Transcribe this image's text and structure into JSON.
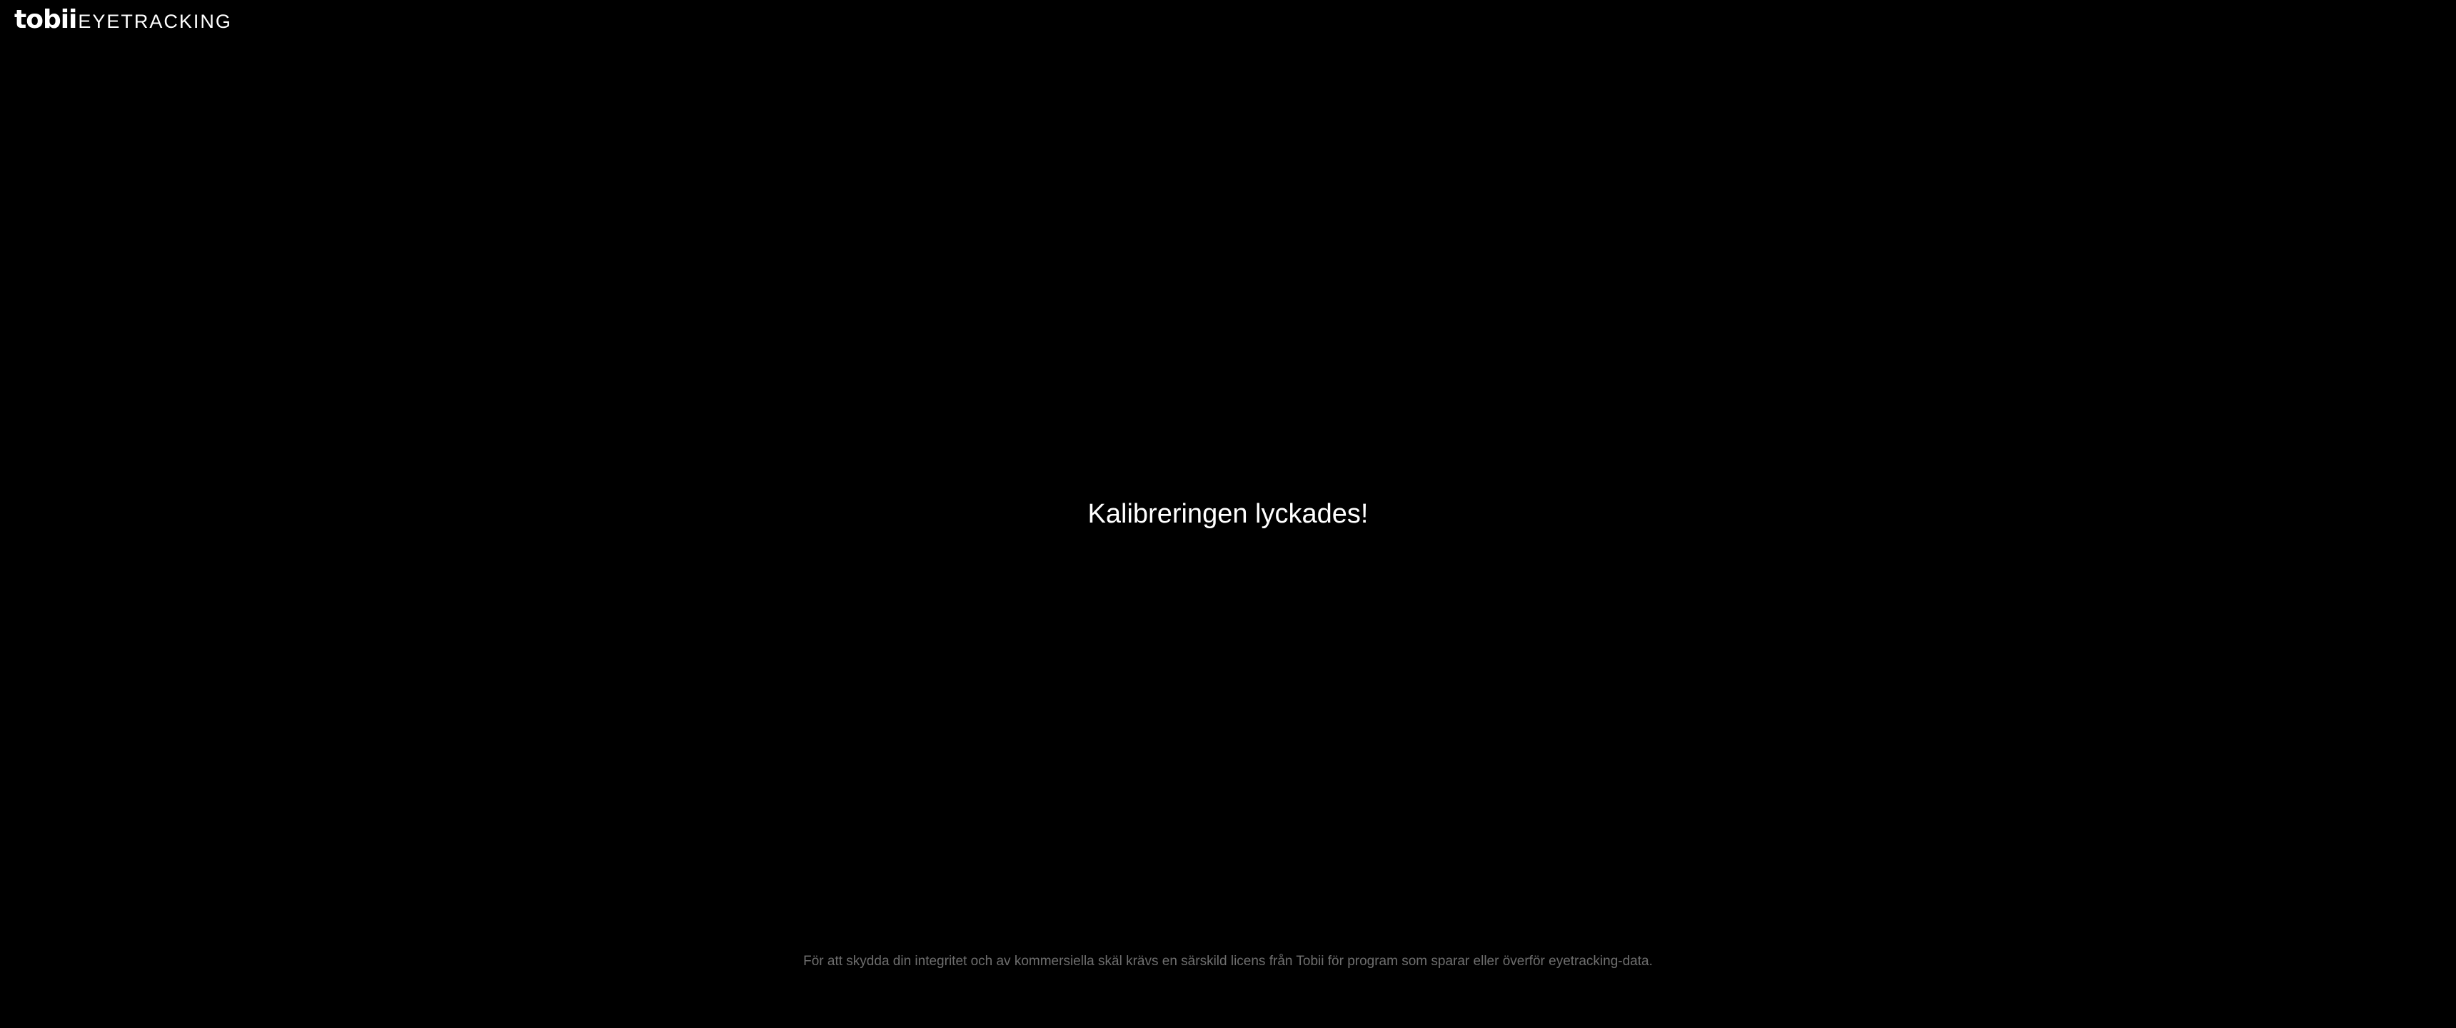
{
  "logo": {
    "brand": "tobii",
    "product": "EYETRACKING"
  },
  "main": {
    "message": "Kalibreringen lyckades!"
  },
  "footer": {
    "notice": "För att skydda din integritet och av kommersiella skäl krävs en särskild licens från Tobii för program som sparar eller överför eyetracking-data."
  },
  "colors": {
    "background": "#000000",
    "text": "#ffffff",
    "notice_text": "#6e6e6e"
  }
}
